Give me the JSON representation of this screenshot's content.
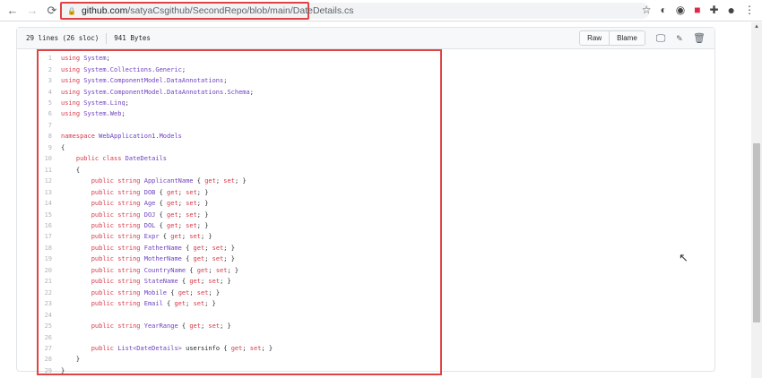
{
  "browser": {
    "url_host": "github.com",
    "url_path": "/satyaCsgithub/SecondRepo/blob/main/DateDetails.cs"
  },
  "file": {
    "lines_info": "29 lines (26 sloc)",
    "size": "941 Bytes",
    "raw_label": "Raw",
    "blame_label": "Blame"
  },
  "code": [
    [
      [
        "k",
        "using "
      ],
      [
        "t",
        "System"
      ],
      [
        "p",
        ";"
      ]
    ],
    [
      [
        "k",
        "using "
      ],
      [
        "t",
        "System.Collections.Generic"
      ],
      [
        "p",
        ";"
      ]
    ],
    [
      [
        "k",
        "using "
      ],
      [
        "t",
        "System.ComponentModel.DataAnnotations"
      ],
      [
        "p",
        ";"
      ]
    ],
    [
      [
        "k",
        "using "
      ],
      [
        "t",
        "System.ComponentModel.DataAnnotations.Schema"
      ],
      [
        "p",
        ";"
      ]
    ],
    [
      [
        "k",
        "using "
      ],
      [
        "t",
        "System.Linq"
      ],
      [
        "p",
        ";"
      ]
    ],
    [
      [
        "k",
        "using "
      ],
      [
        "t",
        "System.Web"
      ],
      [
        "p",
        ";"
      ]
    ],
    [],
    [
      [
        "k",
        "namespace "
      ],
      [
        "t",
        "WebApplication1.Models"
      ]
    ],
    [
      [
        "p",
        "{"
      ]
    ],
    [
      [
        "p",
        "    "
      ],
      [
        "k",
        "public class "
      ],
      [
        "t",
        "DateDetails"
      ]
    ],
    [
      [
        "p",
        "    {"
      ]
    ],
    [
      [
        "p",
        "        "
      ],
      [
        "k",
        "public string "
      ],
      [
        "t",
        "ApplicantName"
      ],
      [
        "p",
        " { "
      ],
      [
        "k",
        "get"
      ],
      [
        "p",
        "; "
      ],
      [
        "k",
        "set"
      ],
      [
        "p",
        "; }"
      ]
    ],
    [
      [
        "p",
        "        "
      ],
      [
        "k",
        "public string "
      ],
      [
        "t",
        "DOB"
      ],
      [
        "p",
        " { "
      ],
      [
        "k",
        "get"
      ],
      [
        "p",
        "; "
      ],
      [
        "k",
        "set"
      ],
      [
        "p",
        "; }"
      ]
    ],
    [
      [
        "p",
        "        "
      ],
      [
        "k",
        "public string "
      ],
      [
        "t",
        "Age"
      ],
      [
        "p",
        " { "
      ],
      [
        "k",
        "get"
      ],
      [
        "p",
        "; "
      ],
      [
        "k",
        "set"
      ],
      [
        "p",
        "; }"
      ]
    ],
    [
      [
        "p",
        "        "
      ],
      [
        "k",
        "public string "
      ],
      [
        "t",
        "DOJ"
      ],
      [
        "p",
        " { "
      ],
      [
        "k",
        "get"
      ],
      [
        "p",
        "; "
      ],
      [
        "k",
        "set"
      ],
      [
        "p",
        "; }"
      ]
    ],
    [
      [
        "p",
        "        "
      ],
      [
        "k",
        "public string "
      ],
      [
        "t",
        "DOL"
      ],
      [
        "p",
        " { "
      ],
      [
        "k",
        "get"
      ],
      [
        "p",
        "; "
      ],
      [
        "k",
        "set"
      ],
      [
        "p",
        "; }"
      ]
    ],
    [
      [
        "p",
        "        "
      ],
      [
        "k",
        "public string "
      ],
      [
        "t",
        "Expr"
      ],
      [
        "p",
        " { "
      ],
      [
        "k",
        "get"
      ],
      [
        "p",
        "; "
      ],
      [
        "k",
        "set"
      ],
      [
        "p",
        "; }"
      ]
    ],
    [
      [
        "p",
        "        "
      ],
      [
        "k",
        "public string "
      ],
      [
        "t",
        "FatherName"
      ],
      [
        "p",
        " { "
      ],
      [
        "k",
        "get"
      ],
      [
        "p",
        "; "
      ],
      [
        "k",
        "set"
      ],
      [
        "p",
        "; }"
      ]
    ],
    [
      [
        "p",
        "        "
      ],
      [
        "k",
        "public string "
      ],
      [
        "t",
        "MotherName"
      ],
      [
        "p",
        " { "
      ],
      [
        "k",
        "get"
      ],
      [
        "p",
        "; "
      ],
      [
        "k",
        "set"
      ],
      [
        "p",
        "; }"
      ]
    ],
    [
      [
        "p",
        "        "
      ],
      [
        "k",
        "public string "
      ],
      [
        "t",
        "CountryName"
      ],
      [
        "p",
        " { "
      ],
      [
        "k",
        "get"
      ],
      [
        "p",
        "; "
      ],
      [
        "k",
        "set"
      ],
      [
        "p",
        "; }"
      ]
    ],
    [
      [
        "p",
        "        "
      ],
      [
        "k",
        "public string "
      ],
      [
        "t",
        "StateName"
      ],
      [
        "p",
        " { "
      ],
      [
        "k",
        "get"
      ],
      [
        "p",
        "; "
      ],
      [
        "k",
        "set"
      ],
      [
        "p",
        "; }"
      ]
    ],
    [
      [
        "p",
        "        "
      ],
      [
        "k",
        "public string "
      ],
      [
        "t",
        "Mobile"
      ],
      [
        "p",
        " { "
      ],
      [
        "k",
        "get"
      ],
      [
        "p",
        "; "
      ],
      [
        "k",
        "set"
      ],
      [
        "p",
        "; }"
      ]
    ],
    [
      [
        "p",
        "        "
      ],
      [
        "k",
        "public string "
      ],
      [
        "t",
        "Email"
      ],
      [
        "p",
        " { "
      ],
      [
        "k",
        "get"
      ],
      [
        "p",
        "; "
      ],
      [
        "k",
        "set"
      ],
      [
        "p",
        "; }"
      ]
    ],
    [],
    [
      [
        "p",
        "        "
      ],
      [
        "k",
        "public string "
      ],
      [
        "t",
        "YearRange"
      ],
      [
        "p",
        " { "
      ],
      [
        "k",
        "get"
      ],
      [
        "p",
        "; "
      ],
      [
        "k",
        "set"
      ],
      [
        "p",
        "; }"
      ]
    ],
    [],
    [
      [
        "p",
        "        "
      ],
      [
        "k",
        "public "
      ],
      [
        "t",
        "List<DateDetails>"
      ],
      [
        "p",
        " usersinfo { "
      ],
      [
        "k",
        "get"
      ],
      [
        "p",
        "; "
      ],
      [
        "k",
        "set"
      ],
      [
        "p",
        "; }"
      ]
    ],
    [
      [
        "p",
        "    }"
      ]
    ],
    [
      [
        "p",
        "}"
      ]
    ]
  ]
}
